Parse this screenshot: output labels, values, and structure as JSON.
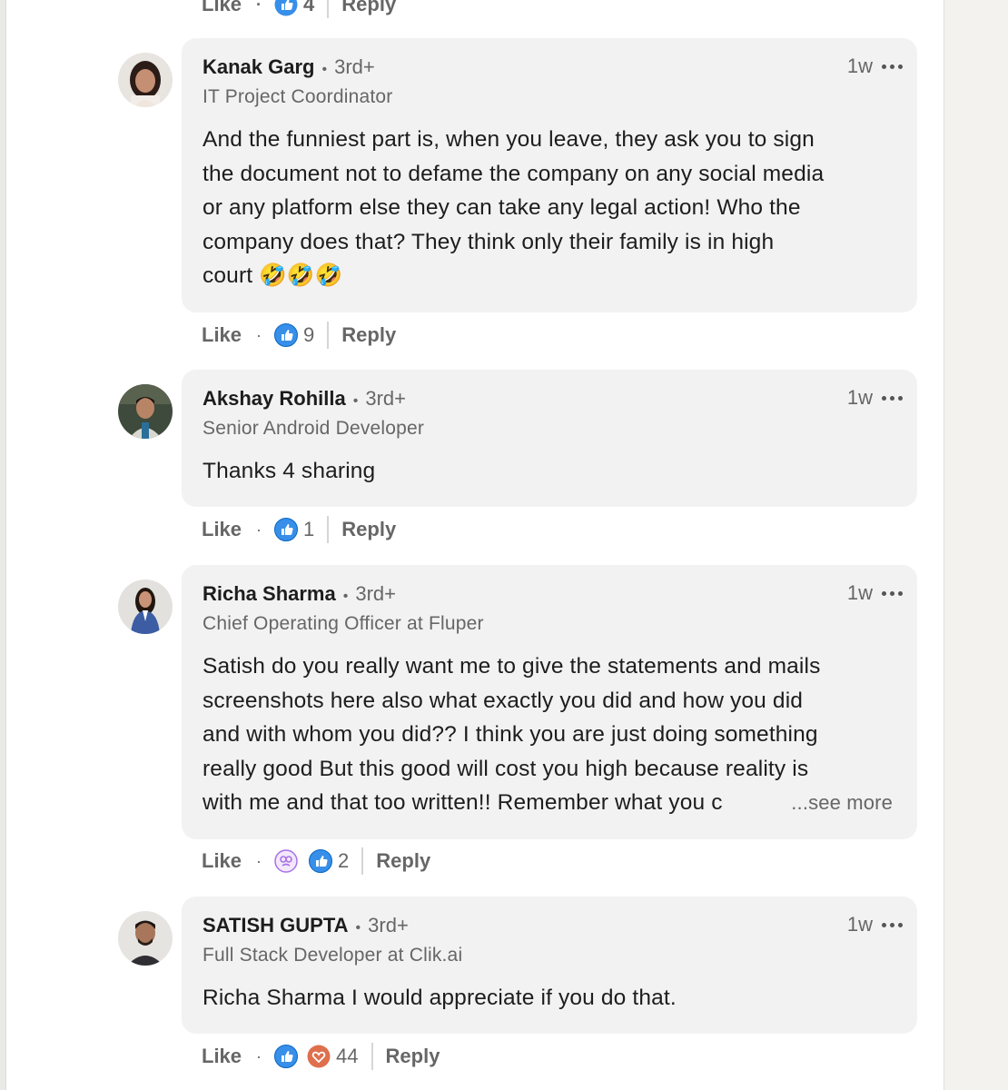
{
  "top_actions": {
    "like": "Like",
    "count": "4",
    "reply": "Reply"
  },
  "comments": [
    {
      "author": "Kanak Garg",
      "degree": "3rd+",
      "headline": "IT Project Coordinator",
      "time": "1w",
      "lines": [
        "And the funniest part is, when you leave, they ask you to sign",
        "the document not to defame the company on any social media",
        "or any platform else they can take any legal action! Who the",
        "company does that? They think only their family is in high",
        "court 🤣🤣🤣"
      ],
      "like": "Like",
      "reaction_count": "9",
      "reply": "Reply",
      "reactions": [
        "like-icon"
      ]
    },
    {
      "author": "Akshay Rohilla",
      "degree": "3rd+",
      "headline": "Senior Android Developer",
      "time": "1w",
      "lines": [
        "Thanks 4 sharing"
      ],
      "like": "Like",
      "reaction_count": "1",
      "reply": "Reply",
      "reactions": [
        "like-icon"
      ]
    },
    {
      "author": "Richa Sharma",
      "degree": "3rd+",
      "headline": "Chief Operating Officer at Fluper",
      "time": "1w",
      "lines": [
        "Satish do you really want me to give the statements and mails",
        "screenshots here also what exactly you did and how you did",
        "and with whom you did?? I think you are just doing something",
        "really good But this good will cost you high because reality is",
        "with me and that too written!! Remember what you c"
      ],
      "see_more": "...see more",
      "like": "Like",
      "reaction_count": "2",
      "reply": "Reply",
      "reactions": [
        "curious-icon",
        "like-icon"
      ]
    },
    {
      "author": "SATISH GUPTA",
      "degree": "3rd+",
      "headline": "Full Stack Developer at Clik.ai",
      "time": "1w",
      "lines": [
        "Richa Sharma I would appreciate if you do that."
      ],
      "like": "Like",
      "reaction_count": "44",
      "reply": "Reply",
      "reactions": [
        "like-icon",
        "love-icon"
      ]
    }
  ],
  "colors": {
    "like_blue": "#378fe9",
    "like_dark": "#0a66c2",
    "love_red": "#df704d",
    "curious_purple": "#a872e8"
  }
}
